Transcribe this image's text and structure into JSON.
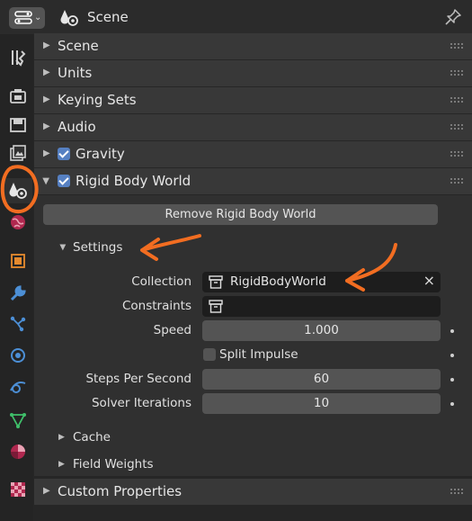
{
  "header": {
    "title": "Scene"
  },
  "panels": {
    "scene": "Scene",
    "units": "Units",
    "keying_sets": "Keying Sets",
    "audio": "Audio",
    "gravity": "Gravity",
    "rigid_body_world": "Rigid Body World",
    "custom_properties": "Custom Properties"
  },
  "rigid_body": {
    "remove_button": "Remove Rigid Body World",
    "settings_label": "Settings",
    "collection_label": "Collection",
    "collection_value": "RigidBodyWorld",
    "constraints_label": "Constraints",
    "constraints_value": "",
    "speed_label": "Speed",
    "speed_value": "1.000",
    "split_impulse_label": "Split Impulse",
    "steps_label": "Steps Per Second",
    "steps_value": "60",
    "solver_label": "Solver Iterations",
    "solver_value": "10",
    "cache_label": "Cache",
    "field_weights_label": "Field Weights"
  },
  "states": {
    "gravity_checked": true,
    "rigid_body_world_checked": true,
    "split_impulse_checked": false
  },
  "colors": {
    "accent_checkbox": "#5680c2",
    "annotation": "#f26d21"
  },
  "icons": {
    "sidebar_tabs": [
      "tool-icon",
      "render-icon",
      "output-icon",
      "view-layer-icon",
      "scene-icon",
      "world-icon",
      "object-icon",
      "modifier-icon",
      "particles-icon",
      "physics-icon",
      "constraints-icon",
      "data-icon",
      "material-icon",
      "texture-icon"
    ]
  }
}
